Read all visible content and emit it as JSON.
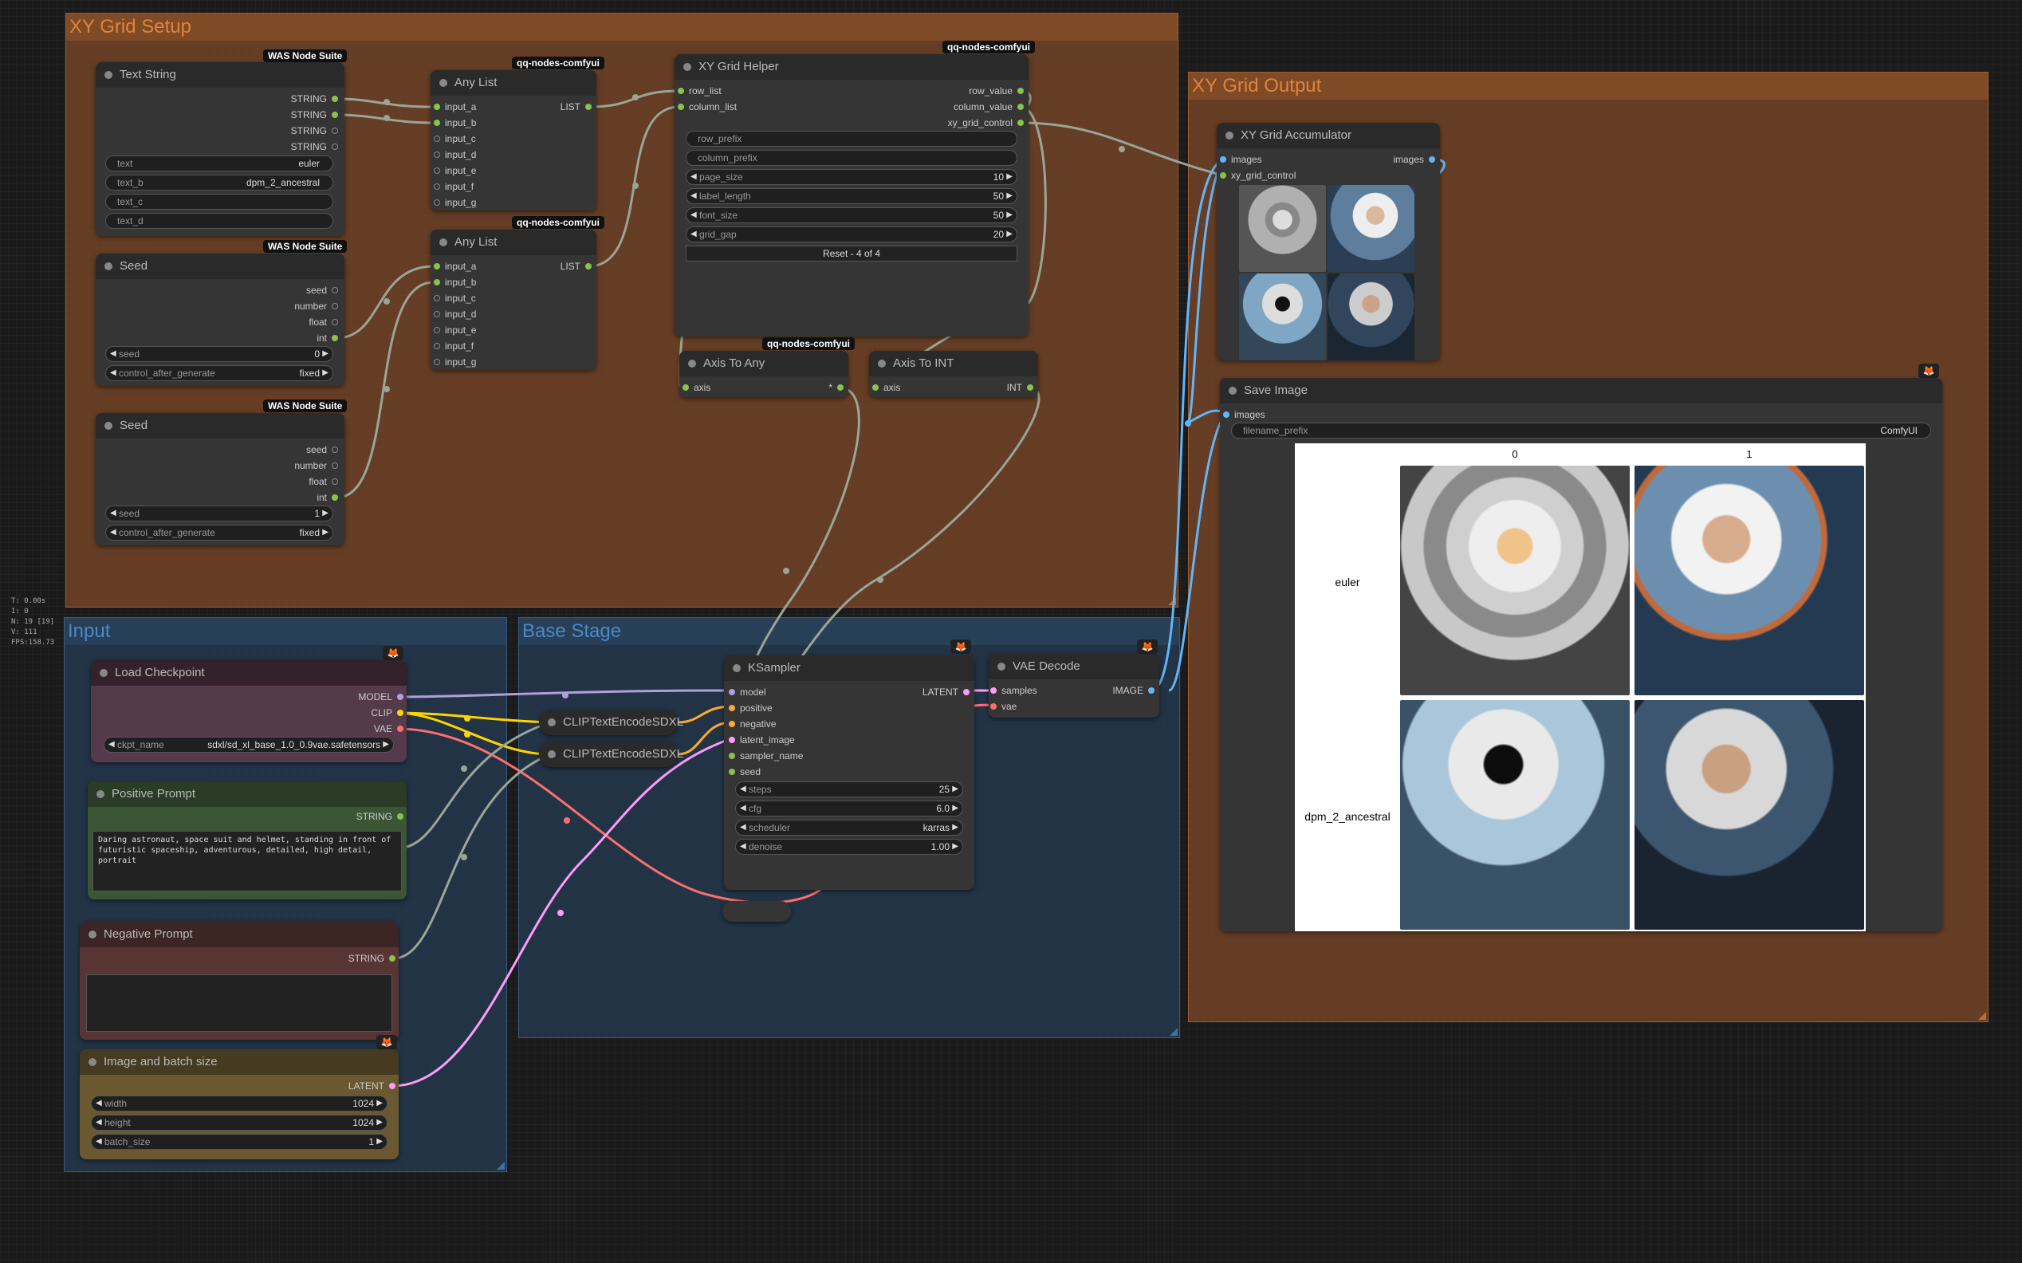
{
  "hud": [
    "T: 0.00s",
    "I: 0",
    "N: 19 [19]",
    "V: 111",
    "FPS:158.73"
  ],
  "groups": {
    "xy_setup": "XY Grid Setup",
    "xy_output": "XY Grid Output",
    "input": "Input",
    "base_stage": "Base Stage"
  },
  "badges": {
    "was": "WAS Node Suite",
    "qq": "qq-nodes-comfyui"
  },
  "fox_icon": "🦊",
  "text_string": {
    "title": "Text String",
    "outputs": [
      "STRING",
      "STRING",
      "STRING",
      "STRING"
    ],
    "widgets": [
      {
        "label": "text",
        "value": "euler"
      },
      {
        "label": "text_b",
        "value": "dpm_2_ancestral"
      },
      {
        "label": "text_c",
        "value": ""
      },
      {
        "label": "text_d",
        "value": ""
      }
    ]
  },
  "seed1": {
    "title": "Seed",
    "outputs": [
      "seed",
      "number",
      "float",
      "int"
    ],
    "widgets": [
      {
        "label": "seed",
        "value": "0"
      },
      {
        "label": "control_after_generate",
        "value": "fixed"
      }
    ]
  },
  "seed2": {
    "title": "Seed",
    "outputs": [
      "seed",
      "number",
      "float",
      "int"
    ],
    "widgets": [
      {
        "label": "seed",
        "value": "1"
      },
      {
        "label": "control_after_generate",
        "value": "fixed"
      }
    ]
  },
  "any_list1": {
    "title": "Any List",
    "inputs": [
      "input_a",
      "input_b",
      "input_c",
      "input_d",
      "input_e",
      "input_f",
      "input_g"
    ],
    "output": "LIST"
  },
  "any_list2": {
    "title": "Any List",
    "inputs": [
      "input_a",
      "input_b",
      "input_c",
      "input_d",
      "input_e",
      "input_f",
      "input_g"
    ],
    "output": "LIST"
  },
  "xy_helper": {
    "title": "XY Grid Helper",
    "inputs": [
      "row_list",
      "column_list"
    ],
    "outputs": [
      "row_value",
      "column_value",
      "xy_grid_control"
    ],
    "text_widgets": [
      "row_prefix",
      "column_prefix"
    ],
    "widgets": [
      {
        "label": "page_size",
        "value": "10"
      },
      {
        "label": "label_length",
        "value": "50"
      },
      {
        "label": "font_size",
        "value": "50"
      },
      {
        "label": "grid_gap",
        "value": "20"
      }
    ],
    "button": "Reset - 4 of 4"
  },
  "axis_any": {
    "title": "Axis To Any",
    "input": "axis",
    "output": "*"
  },
  "axis_int": {
    "title": "Axis To INT",
    "input": "axis",
    "output": "INT"
  },
  "accumulator": {
    "title": "XY Grid Accumulator",
    "inputs": [
      "images",
      "xy_grid_control"
    ],
    "output": "images"
  },
  "save_image": {
    "title": "Save Image",
    "input": "images",
    "widget": {
      "label": "filename_prefix",
      "value": "ComfyUI"
    },
    "grid": {
      "col_labels": [
        "0",
        "1"
      ],
      "row_labels": [
        "euler",
        "dpm_2_ancestral"
      ]
    }
  },
  "load_checkpoint": {
    "title": "Load Checkpoint",
    "outputs": [
      "MODEL",
      "CLIP",
      "VAE"
    ],
    "widget": {
      "label": "ckpt_name",
      "value": "sdxl/sd_xl_base_1.0_0.9vae.safetensors"
    }
  },
  "positive_prompt": {
    "title": "Positive Prompt",
    "output": "STRING",
    "text": "Daring astronaut, space suit and helmet, standing in front of futuristic spaceship, adventurous, detailed, high detail, portrait"
  },
  "negative_prompt": {
    "title": "Negative Prompt",
    "output": "STRING",
    "text": ""
  },
  "image_batch": {
    "title": "Image and batch size",
    "output": "LATENT",
    "widgets": [
      {
        "label": "width",
        "value": "1024"
      },
      {
        "label": "height",
        "value": "1024"
      },
      {
        "label": "batch_size",
        "value": "1"
      }
    ]
  },
  "clip1": {
    "title": "CLIPTextEncodeSDXL"
  },
  "clip2": {
    "title": "CLIPTextEncodeSDXL"
  },
  "ksampler": {
    "title": "KSampler",
    "inputs": [
      "model",
      "positive",
      "negative",
      "latent_image",
      "sampler_name",
      "seed"
    ],
    "output": "LATENT",
    "widgets": [
      {
        "label": "steps",
        "value": "25"
      },
      {
        "label": "cfg",
        "value": "6.0"
      },
      {
        "label": "scheduler",
        "value": "karras"
      },
      {
        "label": "denoise",
        "value": "1.00"
      }
    ]
  },
  "vae_decode": {
    "title": "VAE Decode",
    "inputs": [
      "samples",
      "vae"
    ],
    "output": "IMAGE"
  },
  "colors": {
    "string": "#8bc34a",
    "list": "#8bc34a",
    "int": "#8bc34a",
    "image": "#64b5f6",
    "model": "#b39ddb",
    "clip": "#ffd500",
    "vae": "#ff6e6e",
    "latent": "#ff9cf9",
    "conditioning": "#ffa931",
    "link_gray": "#9aa596"
  }
}
